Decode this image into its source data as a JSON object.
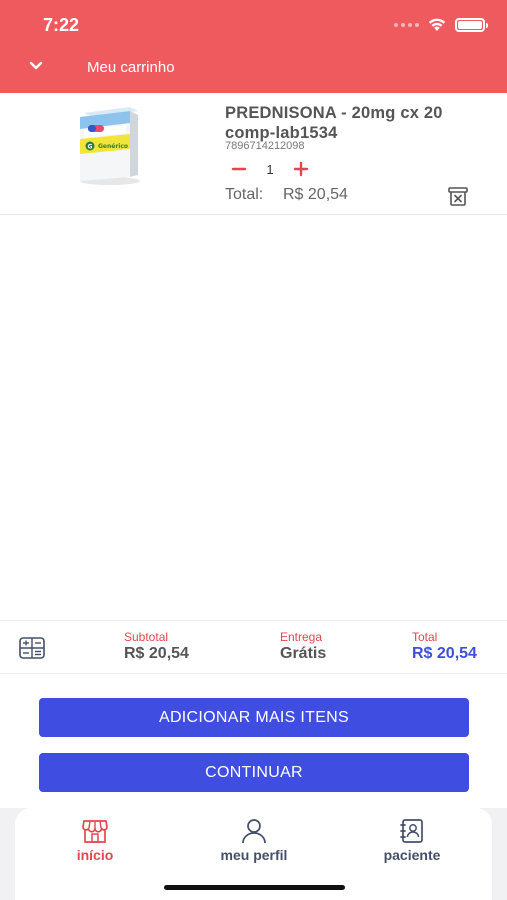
{
  "status": {
    "time": "7:22"
  },
  "header": {
    "title": "Meu carrinho"
  },
  "cart": {
    "items": [
      {
        "name": "PREDNISONA - 20mg cx 20 comp-lab1534",
        "code": "7896714212098",
        "quantity": "1",
        "total_label": "Total:",
        "total_value": "R$ 20,54",
        "box_label": "Genérico",
        "box_letter": "G"
      }
    ]
  },
  "summary": {
    "subtotal_label": "Subtotal",
    "subtotal_value": "R$ 20,54",
    "delivery_label": "Entrega",
    "delivery_value": "Grátis",
    "total_label": "Total",
    "total_value": "R$ 20,54"
  },
  "actions": {
    "add_more_label": "ADICIONAR MAIS ITENS",
    "continue_label": "CONTINUAR"
  },
  "nav": {
    "items": [
      {
        "label": "início",
        "icon": "store-icon",
        "active": true
      },
      {
        "label": "meu perfil",
        "icon": "user-icon",
        "active": false
      },
      {
        "label": "paciente",
        "icon": "patient-card-icon",
        "active": false
      }
    ]
  },
  "colors": {
    "header": "#ef5a5e",
    "primary_button": "#3f4ee0",
    "accent_red": "#e3474d",
    "total_blue": "#3f4ee0"
  }
}
